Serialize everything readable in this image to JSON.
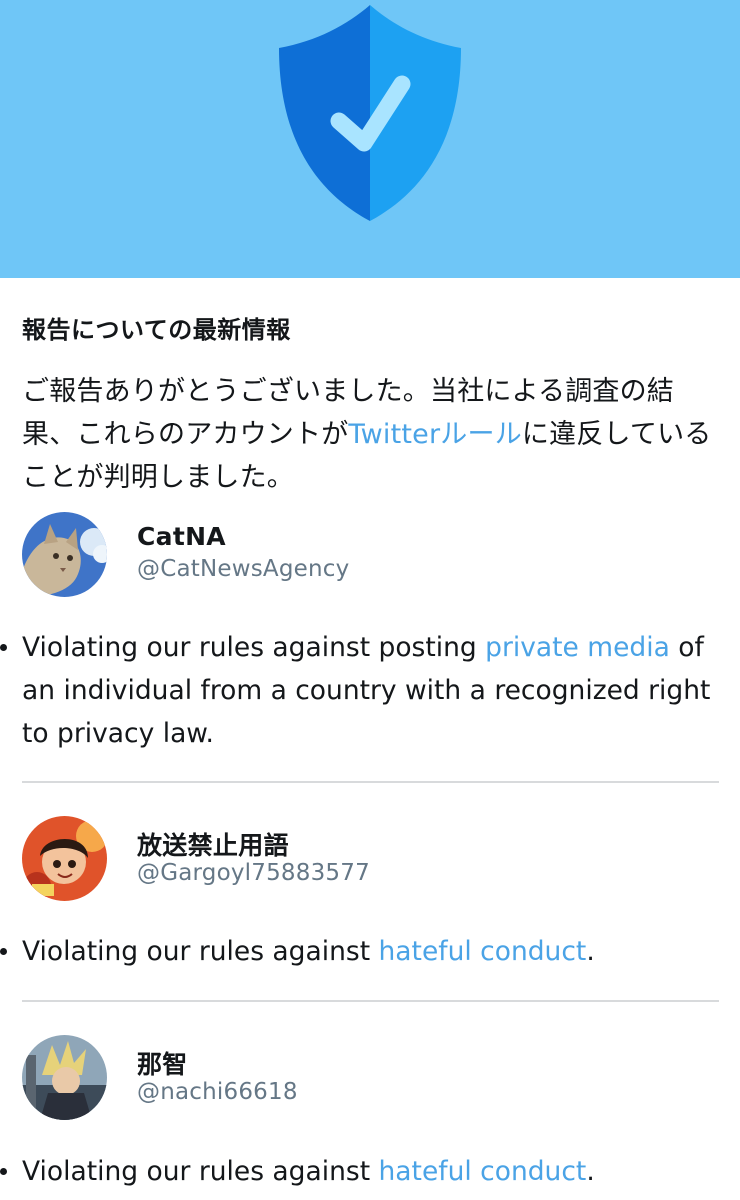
{
  "header": {
    "icon": "shield-check-icon",
    "colors": {
      "background": "#6fc6f7",
      "shield_left": "#0e6fd6",
      "shield_right": "#1da1f2",
      "check": "#a9e4ff"
    }
  },
  "title": "報告についての最新情報",
  "intro": {
    "before_link": "ご報告ありがとうございました。当社による調査の結果、これらのアカウントが",
    "link": "Twitterルール",
    "after_link": "に違反していることが判明しました。"
  },
  "accounts": [
    {
      "name": "CatNA",
      "handle": "@CatNewsAgency",
      "violation": {
        "before": "Violating our rules against posting ",
        "link": "private media",
        "after": " of an individual from a country with a recognized right to privacy law."
      }
    },
    {
      "name": "放送禁止用語",
      "handle": "@Gargoyl75883577",
      "violation": {
        "before": "Violating our rules against ",
        "link": "hateful conduct",
        "after": "."
      }
    },
    {
      "name": "那智",
      "handle": "@nachi66618",
      "violation": {
        "before": "Violating our rules against ",
        "link": "hateful conduct",
        "after": "."
      }
    }
  ],
  "colors": {
    "link": "#4aa3e6",
    "secondary_text": "#657786",
    "divider": "#d8dadc"
  }
}
